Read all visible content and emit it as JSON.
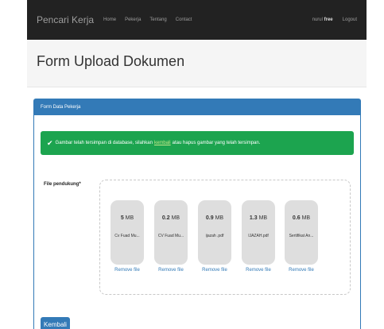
{
  "navbar": {
    "brand": "Pencari Kerja",
    "links": [
      "Home",
      "Pekerja",
      "Tentang",
      "Contact"
    ],
    "user_prefix": "nurul",
    "user_name": "free",
    "logout": "Logout"
  },
  "page": {
    "title": "Form Upload Dokumen"
  },
  "panel": {
    "heading": "Form Data Pekerja",
    "alert": {
      "icon": "check-icon",
      "text_before": "Gambar telah tersimpan di database, silahkan",
      "link": "kembali",
      "text_after": "atau hapus gambar yang telah tersimpan."
    },
    "field_label": "File pendukung*",
    "files": [
      {
        "size_value": "5",
        "size_unit": "MB",
        "name": "Cv Fuad Mu..."
      },
      {
        "size_value": "0.2",
        "size_unit": "MB",
        "name": "CV Fuad Mu..."
      },
      {
        "size_value": "0.9",
        "size_unit": "MB",
        "name": "ijazah .pdf"
      },
      {
        "size_value": "1.3",
        "size_unit": "MB",
        "name": "IJAZAH.pdf"
      },
      {
        "size_value": "0.6",
        "size_unit": "MB",
        "name": "Sertifikat An..."
      }
    ],
    "remove_label": "Remove file",
    "back_button": "Kembali"
  },
  "colors": {
    "navbar": "#222222",
    "primary": "#337ab7",
    "success": "#1ca44f",
    "file_bg": "#dedede"
  }
}
